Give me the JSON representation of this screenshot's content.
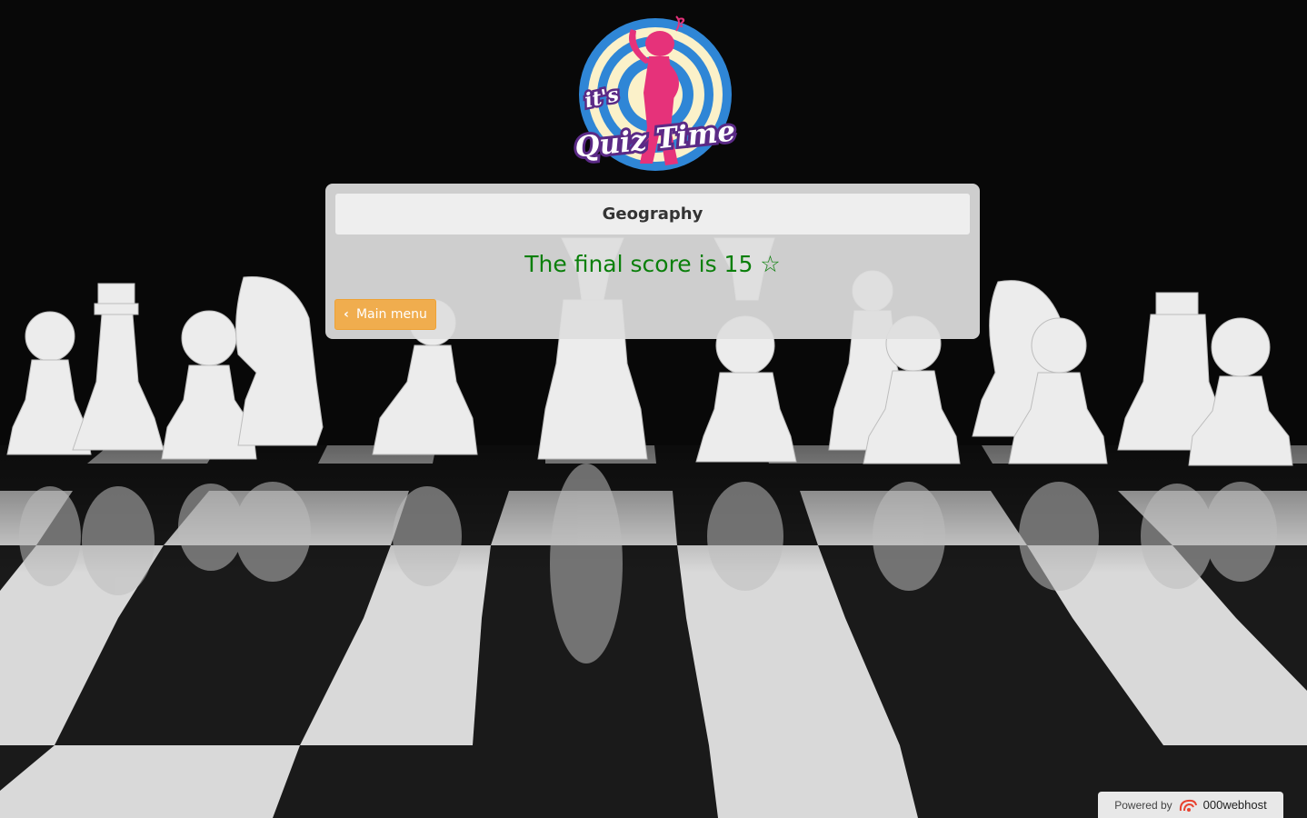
{
  "panel": {
    "category_title": "Geography",
    "score_text": "The final score is 15 ☆",
    "main_menu_label": "Main menu"
  },
  "logo": {
    "top_text": "it's",
    "bottom_text": "Quiz Time"
  },
  "footer": {
    "powered_label": "Powered by",
    "brand_label": "000webhost"
  },
  "colors": {
    "score_green": "#0a7f0a",
    "button_orange": "#f0ad4e",
    "logo_ring_blue": "#2f86d6",
    "logo_figure_pink": "#e6327a",
    "logo_text_purple": "#5b2a86"
  }
}
